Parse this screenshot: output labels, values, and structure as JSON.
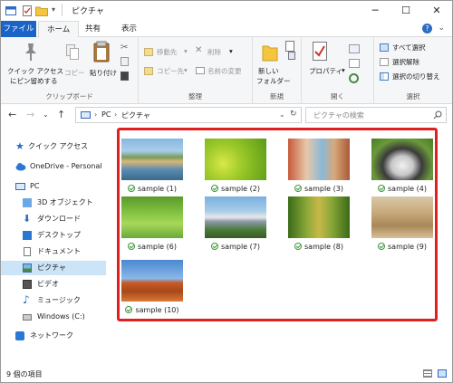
{
  "window": {
    "title": "ピクチャ",
    "buttons": {
      "minimize": "─",
      "maximize": "☐",
      "close": "✕"
    }
  },
  "tabs": {
    "file": "ファイル",
    "home": "ホーム",
    "share": "共有",
    "view": "表示"
  },
  "ribbon": {
    "clipboard": {
      "label": "クリップボード",
      "pin_line1": "クイック アクセス",
      "pin_line2": "にピン留めする",
      "copy": "コピー",
      "paste": "貼り付け"
    },
    "organize": {
      "label": "整理",
      "move_to": "移動先",
      "copy_to": "コピー先",
      "delete": "削除",
      "rename": "名前の変更"
    },
    "new": {
      "label": "新規",
      "new_folder_line1": "新しい",
      "new_folder_line2": "フォルダー"
    },
    "open": {
      "label": "開く",
      "properties": "プロパティ"
    },
    "select": {
      "label": "選択",
      "select_all": "すべて選択",
      "select_none": "選択解除",
      "invert": "選択の切り替え"
    }
  },
  "address": {
    "crumbs": [
      "PC",
      "ピクチャ"
    ],
    "search_placeholder": "ピクチャの検索"
  },
  "sidebar": {
    "items": [
      {
        "label": "クイック アクセス",
        "icon": "star-icon"
      },
      {
        "label": "OneDrive - Personal",
        "icon": "cloud-icon"
      },
      {
        "label": "PC",
        "icon": "pc-icon"
      },
      {
        "label": "3D オブジェクト",
        "icon": "cube-icon"
      },
      {
        "label": "ダウンロード",
        "icon": "download-icon"
      },
      {
        "label": "デスクトップ",
        "icon": "desktop-icon"
      },
      {
        "label": "ドキュメント",
        "icon": "document-icon"
      },
      {
        "label": "ピクチャ",
        "icon": "pictures-icon"
      },
      {
        "label": "ビデオ",
        "icon": "video-icon"
      },
      {
        "label": "ミュージック",
        "icon": "music-icon"
      },
      {
        "label": "Windows (C:)",
        "icon": "drive-icon"
      },
      {
        "label": "ネットワーク",
        "icon": "network-icon"
      }
    ]
  },
  "files": [
    {
      "name": "sample (1)"
    },
    {
      "name": "sample (2)"
    },
    {
      "name": "sample (3)"
    },
    {
      "name": "sample (4)"
    },
    {
      "name": "sample (6)"
    },
    {
      "name": "sample (7)"
    },
    {
      "name": "sample (8)"
    },
    {
      "name": "sample (9)"
    },
    {
      "name": "sample (10)"
    }
  ],
  "status": {
    "count": "9 個の項目"
  },
  "colors": {
    "accent": "#1a64c8",
    "highlight": "#e02020",
    "selected": "#cce4f7"
  }
}
